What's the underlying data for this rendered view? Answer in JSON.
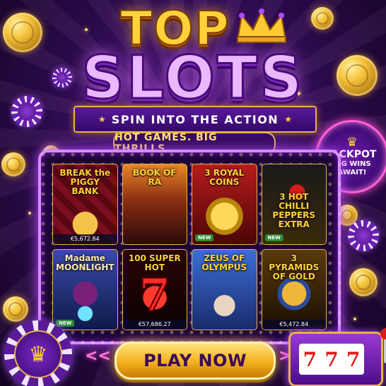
{
  "header": {
    "title_top": "TOP",
    "title_main": "SLOTS",
    "ribbon_text": "SPIN INTO THE ACTION",
    "tagline": "HOT GAMES. BIG THRILLS."
  },
  "jackpot": {
    "title": "JACKPOT",
    "line1": "BIG WINS",
    "line2": "AWAIT!"
  },
  "games": [
    {
      "name": "BREAK the PIGGY BANK",
      "amount": "€5,672.84",
      "badge": "",
      "name_color": "#ffd23a"
    },
    {
      "name": "BOOK OF RA",
      "amount": "",
      "badge": "",
      "name_color": "#ffd23a"
    },
    {
      "name": "3 ROYAL COINS",
      "amount": "",
      "badge": "NEW",
      "name_color": "#ffd23a"
    },
    {
      "name": "3 HOT CHILLI PEPPERS EXTRA",
      "amount": "",
      "badge": "NEW",
      "name_color": "#ffd23a"
    },
    {
      "name": "Madame MOONLIGHT",
      "amount": "",
      "badge": "NEW",
      "name_color": "#ffe9b0"
    },
    {
      "name": "100 SUPER HOT",
      "amount": "€57,686.27",
      "badge": "",
      "name_color": "#ffd23a"
    },
    {
      "name": "ZEUS OF OLYMPUS",
      "amount": "",
      "badge": "",
      "name_color": "#ffd23a"
    },
    {
      "name": "3 PYRAMIDS OF GOLD",
      "amount": "€5,472.84",
      "badge": "",
      "name_color": "#ffd23a"
    }
  ],
  "cta": {
    "label": "PLAY NOW",
    "chevrons_left": "<<",
    "chevrons_right": ">>"
  },
  "icons": {
    "chip_symbol": "♛",
    "reel_symbol": "7",
    "seven_symbol": "7"
  },
  "colors": {
    "accent_gold": "#ffd23a",
    "accent_purple": "#7b2bc4",
    "accent_pink": "#ff5fd6"
  }
}
